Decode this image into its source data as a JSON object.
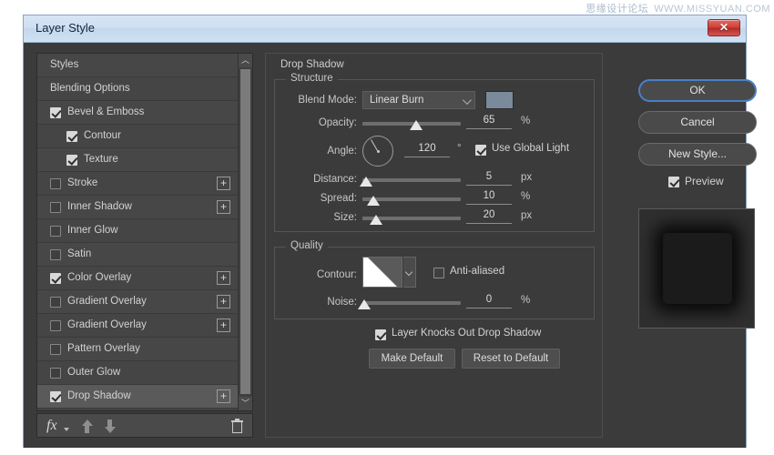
{
  "watermark": {
    "cn": "思缘设计论坛",
    "url": "WWW.MISSYUAN.COM"
  },
  "window": {
    "title": "Layer Style",
    "close_label": "✕"
  },
  "styles_panel": {
    "items": [
      {
        "label": "Styles",
        "indent": "plain",
        "checkbox": "none",
        "plus": false
      },
      {
        "label": "Blending Options",
        "indent": "plain",
        "checkbox": "none",
        "plus": false
      },
      {
        "label": "Bevel & Emboss",
        "indent": "lvl0",
        "checkbox": "checked",
        "plus": false
      },
      {
        "label": "Contour",
        "indent": "lvl1",
        "checkbox": "checked",
        "plus": false
      },
      {
        "label": "Texture",
        "indent": "lvl1",
        "checkbox": "checked",
        "plus": false
      },
      {
        "label": "Stroke",
        "indent": "lvl0",
        "checkbox": "unchecked",
        "plus": true
      },
      {
        "label": "Inner Shadow",
        "indent": "lvl0",
        "checkbox": "unchecked",
        "plus": true
      },
      {
        "label": "Inner Glow",
        "indent": "lvl0",
        "checkbox": "unchecked",
        "plus": false
      },
      {
        "label": "Satin",
        "indent": "lvl0",
        "checkbox": "unchecked",
        "plus": false
      },
      {
        "label": "Color Overlay",
        "indent": "lvl0",
        "checkbox": "checked",
        "plus": true
      },
      {
        "label": "Gradient Overlay",
        "indent": "lvl0",
        "checkbox": "unchecked",
        "plus": true
      },
      {
        "label": "Gradient Overlay",
        "indent": "lvl0",
        "checkbox": "unchecked",
        "plus": true
      },
      {
        "label": "Pattern Overlay",
        "indent": "lvl0",
        "checkbox": "unchecked",
        "plus": false
      },
      {
        "label": "Outer Glow",
        "indent": "lvl0",
        "checkbox": "unchecked",
        "plus": false
      },
      {
        "label": "Drop Shadow",
        "indent": "lvl0",
        "checkbox": "checked",
        "plus": true,
        "selected": true
      }
    ],
    "plus_glyph": "+",
    "scroll_up_glyph": "︿",
    "scroll_down_glyph": "﹀"
  },
  "fx_toolbar": {
    "fx_label": "fx",
    "up_title": "Move up",
    "down_title": "Move down",
    "trash_title": "Delete effect"
  },
  "settings": {
    "section_title": "Drop Shadow",
    "structure": {
      "title": "Structure",
      "blend_mode": {
        "label": "Blend Mode:",
        "value": "Linear Burn",
        "swatch_color": "#7a8a9a"
      },
      "opacity": {
        "label": "Opacity:",
        "value": "65",
        "unit": "%",
        "slider_pct": 55
      },
      "angle": {
        "label": "Angle:",
        "value": "120",
        "unit": "°",
        "degrees": 120
      },
      "use_global_light": {
        "label": "Use Global Light",
        "checked": true
      },
      "distance": {
        "label": "Distance:",
        "value": "5",
        "unit": "px",
        "slider_pct": 4
      },
      "spread": {
        "label": "Spread:",
        "value": "10",
        "unit": "%",
        "slider_pct": 11
      },
      "size": {
        "label": "Size:",
        "value": "20",
        "unit": "px",
        "slider_pct": 14
      }
    },
    "quality": {
      "title": "Quality",
      "contour": {
        "label": "Contour:"
      },
      "anti_aliased": {
        "label": "Anti-aliased",
        "checked": false
      },
      "noise": {
        "label": "Noise:",
        "value": "0",
        "unit": "%",
        "slider_pct": 2
      }
    },
    "knockout": {
      "label": "Layer Knocks Out Drop Shadow",
      "checked": true
    },
    "make_default_label": "Make Default",
    "reset_default_label": "Reset to Default"
  },
  "right_panel": {
    "ok_label": "OK",
    "cancel_label": "Cancel",
    "new_style_label": "New Style...",
    "preview": {
      "label": "Preview",
      "checked": true
    }
  }
}
